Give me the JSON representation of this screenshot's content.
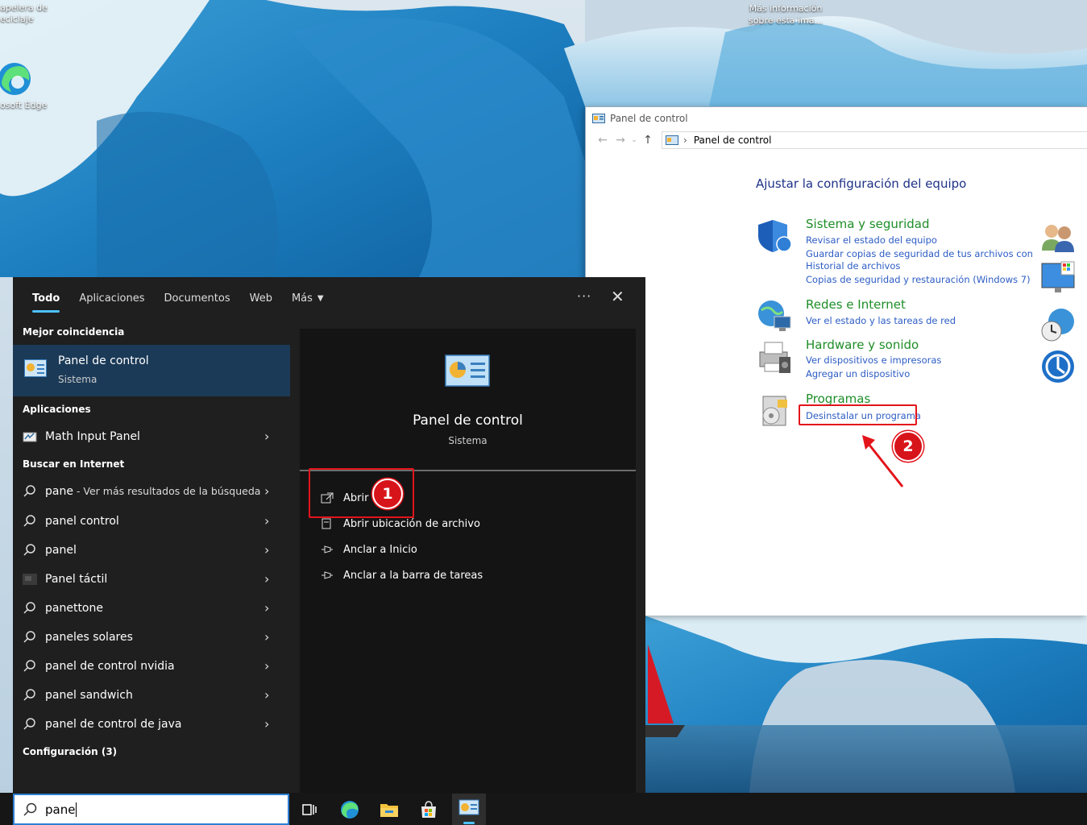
{
  "desktop": {
    "recycle_bin_label_1": "apelera de",
    "recycle_bin_label_2": "eciclaje",
    "edge_label": "osoft Edge",
    "info_label_1": "Más información",
    "info_label_2": "sobre esta ima..."
  },
  "control_panel": {
    "window_title": "Panel de control",
    "breadcrumb": "Panel de control",
    "heading": "Ajustar la configuración del equipo",
    "categories": [
      {
        "title": "Sistema y seguridad",
        "links": [
          "Revisar el estado del equipo",
          "Guardar copias de seguridad de tus archivos con",
          "Historial de archivos",
          "Copias de seguridad y restauración (Windows 7)"
        ],
        "icon": "shield-icon"
      },
      {
        "title": "Redes e Internet",
        "links": [
          "Ver el estado y las tareas de red"
        ],
        "icon": "network-icon"
      },
      {
        "title": "Hardware y sonido",
        "links": [
          "Ver dispositivos e impresoras",
          "Agregar un dispositivo"
        ],
        "icon": "printer-icon"
      },
      {
        "title": "Programas",
        "links": [
          "Desinstalar un programa"
        ],
        "icon": "programs-icon"
      }
    ]
  },
  "annotations": {
    "badge_1": "1",
    "badge_2": "2",
    "accent": "#e3141b"
  },
  "search": {
    "tabs": [
      "Todo",
      "Aplicaciones",
      "Documentos",
      "Web",
      "Más"
    ],
    "active_tab": "Todo",
    "more_icon": "ellipsis-icon",
    "close_icon": "close-icon",
    "best_match_header": "Mejor coincidencia",
    "best_match_title": "Panel de control",
    "best_match_sub": "Sistema",
    "apps_header": "Aplicaciones",
    "apps": [
      {
        "label": "Math Input Panel"
      }
    ],
    "web_header": "Buscar en Internet",
    "web_results": [
      {
        "label": "pane",
        "suffix": " - Ver más resultados de la búsqueda"
      },
      {
        "label": "panel control"
      },
      {
        "label": "panel"
      },
      {
        "label": "Panel táctil"
      },
      {
        "label": "panettone"
      },
      {
        "label": "paneles solares"
      },
      {
        "label": "panel de control nvidia"
      },
      {
        "label": "panel sandwich"
      },
      {
        "label": "panel de control de java"
      }
    ],
    "settings_header": "Configuración (3)",
    "preview_title": "Panel de control",
    "preview_sub": "Sistema",
    "actions": [
      "Abrir",
      "Abrir ubicación de archivo",
      "Anclar a Inicio",
      "Anclar a la barra de tareas"
    ],
    "query": "pane",
    "accent": "#4cc2ff"
  }
}
